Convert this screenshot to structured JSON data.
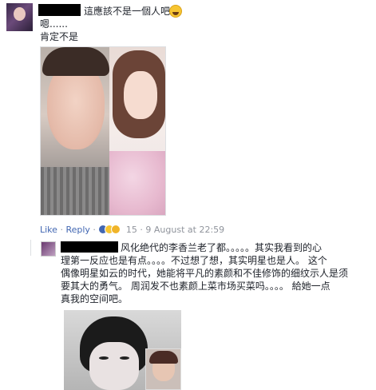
{
  "comment": {
    "text": "這應該不是一個人吧",
    "line2": "嗯......",
    "line3": "肯定不是",
    "emoji": "laughing-emoji"
  },
  "actions": {
    "like": "Like",
    "reply": "Reply",
    "reaction_count": "15",
    "timestamp": "9 August at 22:59",
    "reactions": [
      "like",
      "haha",
      "tongue"
    ]
  },
  "reply": {
    "line1": "风化绝代的李香兰老了都。。。。。其实我看到的心",
    "line2": "理第一反应也是有点。。。。不过想了想，其实明星也是人。 这个",
    "line3": "偶像明星如云的时代，她能将平凡的素颜和不佳修饰的细纹示人是须",
    "line4": "要其大的勇气。 周润发不也素颜上菜市场买菜吗。。。。 給她一点",
    "line5": "真我的空间吧。"
  },
  "colors": {
    "link": "#4267b2",
    "muted": "#90949c",
    "text": "#1d2129"
  }
}
